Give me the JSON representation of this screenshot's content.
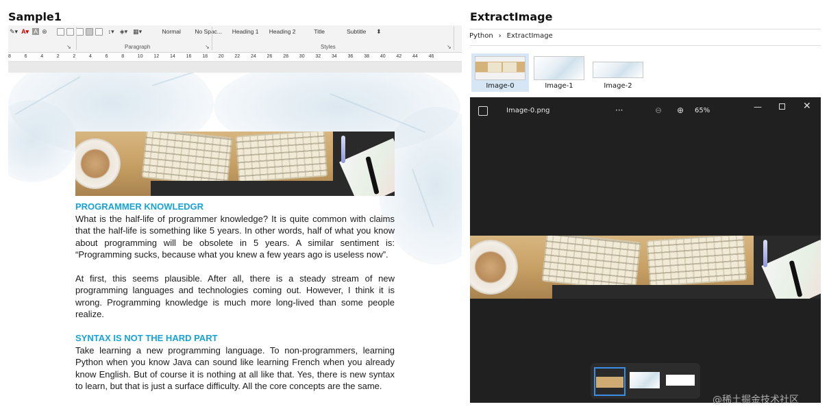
{
  "left_panel": {
    "title": "Sample1",
    "ribbon": {
      "styles": [
        "Normal",
        "No Spac...",
        "Heading 1",
        "Heading 2",
        "Title",
        "Subtitle"
      ],
      "group_paragraph": "Paragraph",
      "group_styles": "Styles"
    },
    "ruler_ticks": [
      "8",
      "6",
      "4",
      "2",
      "2",
      "4",
      "6",
      "8",
      "10",
      "12",
      "14",
      "16",
      "18",
      "20",
      "22",
      "24",
      "26",
      "28",
      "30",
      "32",
      "34",
      "36",
      "38",
      "40",
      "42",
      "44",
      "46"
    ],
    "document": {
      "heading1": "PROGRAMMER KNOWLEDGR",
      "para1": "What is the half-life of programmer knowledge? It is quite common with claims that the half-life is something like 5 years. In other words, half of what you know about programming will be obsolete in 5 years. A similar sentiment is: “Programming sucks, because what you knew a few years ago is useless now”.",
      "para2": "At first, this seems plausible. After all, there is a steady stream of new programming languages and technologies coming out. However, I think it is wrong. Programming knowledge is much more long-lived than some people realize.",
      "heading2": "SYNTAX IS NOT THE HARD PART",
      "para3": "Take learning a new programming language. To non-programmers, learning Python when you know Java can sound like learning French when you already know English. But of course it is nothing at all like that. Yes, there is new syntax to learn, but that is just a surface difficulty. All the core concepts are the same."
    }
  },
  "right_panel": {
    "title": "ExtractImage",
    "breadcrumb": [
      "Python",
      "›",
      "ExtractImage"
    ],
    "thumbnails": [
      {
        "label": "Image-0",
        "selected": true
      },
      {
        "label": "Image-1",
        "selected": false
      },
      {
        "label": "Image-2",
        "selected": false
      }
    ],
    "viewer": {
      "filename": "Image-0.png",
      "more": "···",
      "zoom": "65%",
      "zoom_out_icon": "zoom-out-icon",
      "zoom_in_icon": "zoom-in-icon"
    }
  },
  "watermark": "@稀土掘金技术社区"
}
